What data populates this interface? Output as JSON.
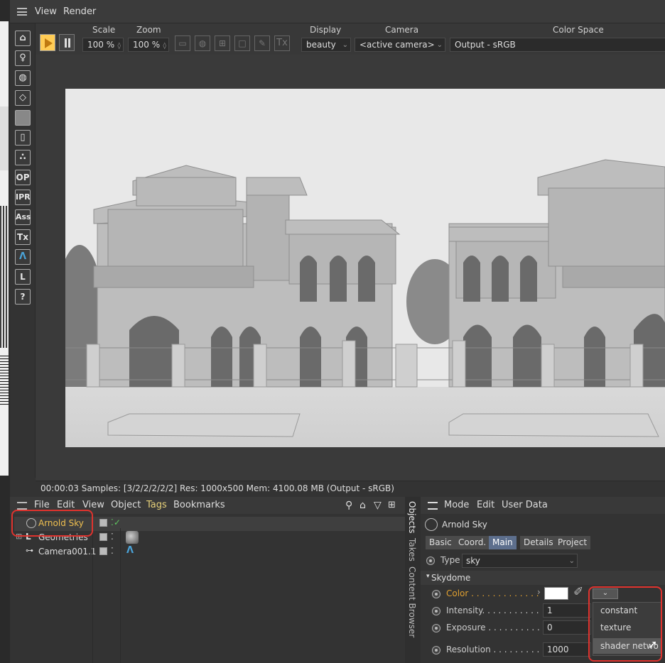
{
  "menubar": {
    "items": [
      "View",
      "Render"
    ]
  },
  "toolbar": {
    "scale_label": "Scale",
    "scale_value": "100 %",
    "zoom_label": "Zoom",
    "zoom_value": "100 %",
    "tx_label": "Tx",
    "display_label": "Display",
    "display_value": "beauty",
    "camera_label": "Camera",
    "camera_value": "<active camera>",
    "colorspace_label": "Color Space",
    "colorspace_value": "Output - sRGB"
  },
  "vtoolbar": {
    "buttons": [
      "OP",
      "IPR",
      "Ass",
      "Tx",
      "L",
      "?"
    ]
  },
  "status": {
    "text": "00:00:03  Samples: [3/2/2/2/2/2]  Res: 1000x500  Mem: 4100.08 MB  (Output - sRGB)"
  },
  "objects": {
    "menu": [
      "File",
      "Edit",
      "View",
      "Object",
      "Tags",
      "Bookmarks"
    ],
    "rows": [
      {
        "name": "Arnold Sky"
      },
      {
        "name": "Geometries"
      },
      {
        "name": "Camera001.1"
      }
    ]
  },
  "vtabs": [
    "Objects",
    "Takes",
    "Content Browser"
  ],
  "attributes": {
    "menu": [
      "Mode",
      "Edit",
      "User Data"
    ],
    "object_name": "Arnold Sky",
    "tabs": [
      "Basic",
      "Coord.",
      "Main",
      "Details",
      "Project"
    ],
    "active_tab": "Main",
    "type_label": "Type",
    "type_value": "sky",
    "section": "Skydome",
    "color_label": "Color . . . . . . . . . . . . .",
    "intensity_label": "Intensity. . . . . . . . . . . .",
    "intensity_value": "1",
    "exposure_label": "Exposure . . . . . . . . . . .",
    "exposure_value": "0",
    "resolution_label": "Resolution . . . . . . . . . .",
    "resolution_value": "1000",
    "dropdown": [
      "constant",
      "texture",
      "shader netwo"
    ]
  },
  "colors": {
    "accent_red": "#e0332e",
    "selected_orange": "#f0c050",
    "active_tab": "#5d6f8d"
  }
}
